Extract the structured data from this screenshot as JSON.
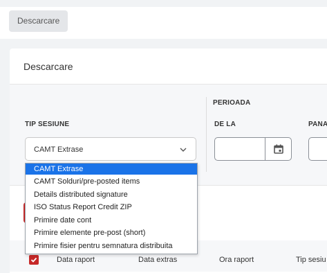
{
  "breadcrumb": {
    "label": "Descarcare"
  },
  "card": {
    "title": "Descarcare"
  },
  "filters": {
    "tip_sesiune_label": "TIP SESIUNE",
    "tip_sesiune_value": "CAMT Extrase",
    "perioada_label": "PERIOADA",
    "de_la_label": "DE LA",
    "pana_label": "PANA",
    "de_la_value": "",
    "pana_value": ""
  },
  "dropdown": {
    "options": [
      {
        "label": "CAMT Extrase",
        "selected": true
      },
      {
        "label": "CAMT Solduri/pre-posted items",
        "selected": false
      },
      {
        "label": "Details distributed signature",
        "selected": false
      },
      {
        "label": "ISO Status Report Credit ZIP",
        "selected": false
      },
      {
        "label": "Primire date cont",
        "selected": false
      },
      {
        "label": "Primire elemente pre-post (short)",
        "selected": false
      },
      {
        "label": "Primire fisier pentru semnatura distribuita",
        "selected": false
      }
    ]
  },
  "table": {
    "columns": [
      "Data raport",
      "Data extras",
      "Ora raport",
      "Tip sesiu"
    ]
  },
  "colors": {
    "accent_red": "#c62828",
    "selection_blue": "#1a73e8"
  },
  "icons": {
    "calendar": "calendar-icon",
    "chevron": "chevron-down-icon",
    "check": "check-icon"
  }
}
